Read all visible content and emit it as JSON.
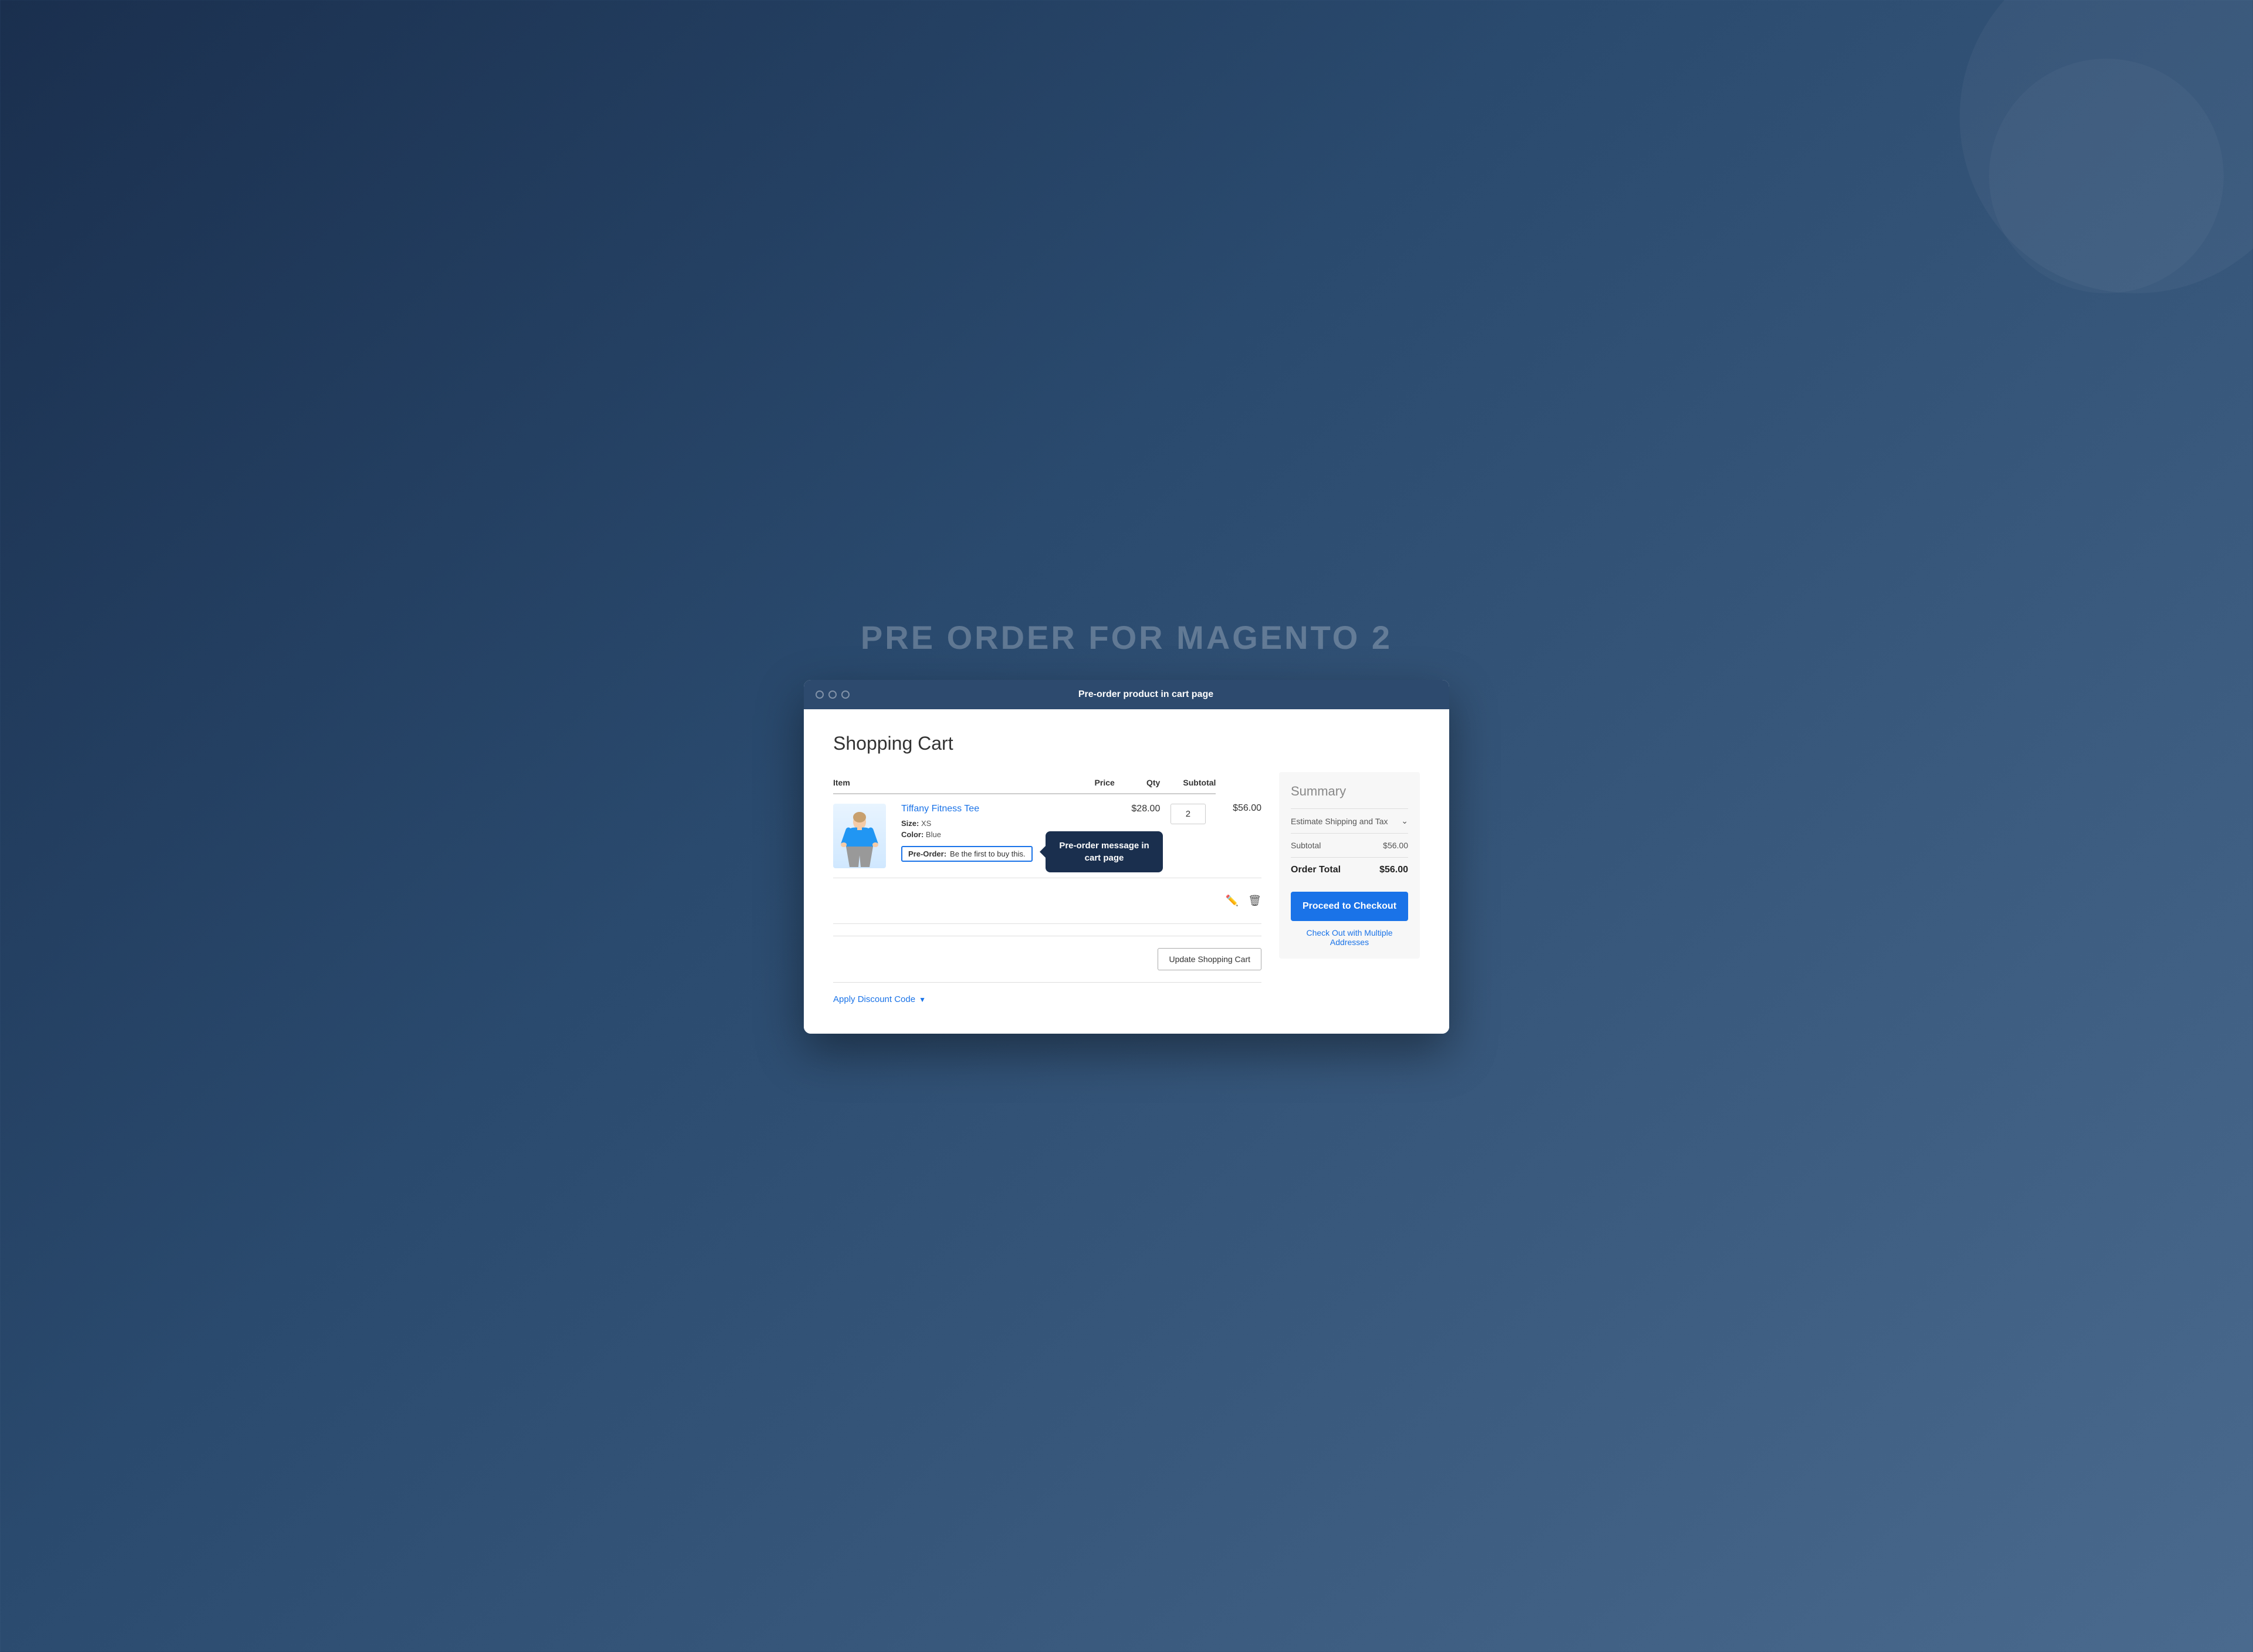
{
  "page": {
    "title": "PRE ORDER FOR MAGENTO 2",
    "browser_tab": "Pre-order product in cart page"
  },
  "cart": {
    "heading": "Shopping Cart",
    "columns": {
      "item": "Item",
      "price": "Price",
      "qty": "Qty",
      "subtotal": "Subtotal"
    },
    "items": [
      {
        "name": "Tiffany Fitness Tee",
        "size": "XS",
        "color": "Blue",
        "preorder_label": "Pre-Order:",
        "preorder_message": "Be the first to buy this.",
        "price": "$28.00",
        "qty": "2",
        "subtotal": "$56.00"
      }
    ],
    "tooltip": {
      "text": "Pre-order message in cart page"
    },
    "update_button": "Update Shopping Cart",
    "discount_label": "Apply Discount Code"
  },
  "summary": {
    "title": "Summary",
    "estimate_shipping": "Estimate Shipping and Tax",
    "subtotal_label": "Subtotal",
    "subtotal_value": "$56.00",
    "order_total_label": "Order Total",
    "order_total_value": "$56.00",
    "checkout_button": "Proceed to Checkout",
    "multi_address_link": "Check Out with Multiple Addresses"
  }
}
